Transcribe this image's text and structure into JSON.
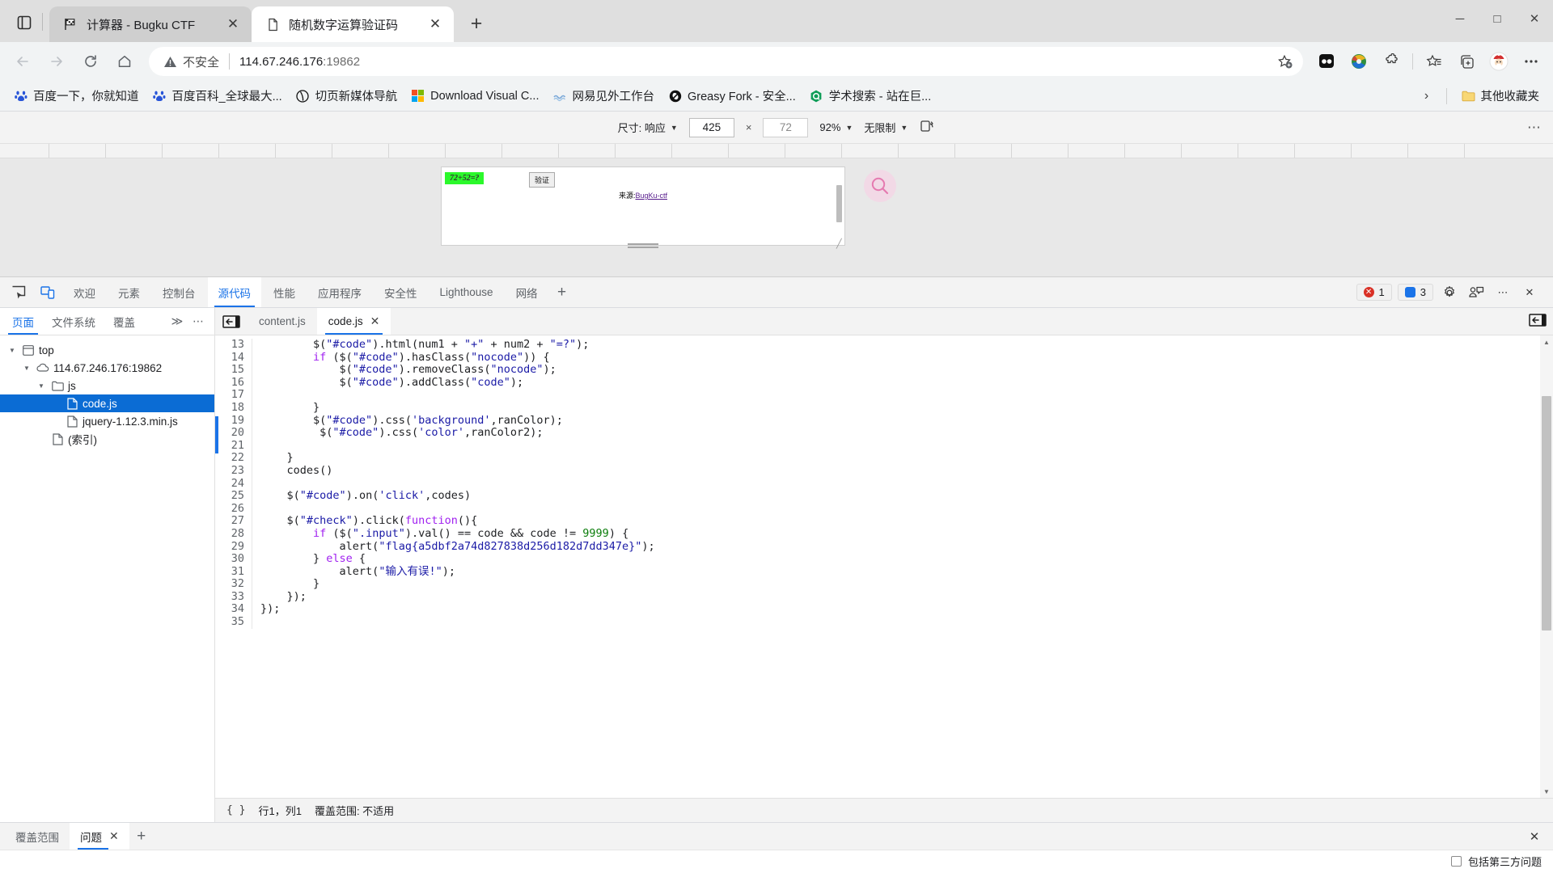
{
  "browser": {
    "tabs": [
      {
        "title": "计算器 - Bugku CTF",
        "favicon": "flag-icon",
        "active": false
      },
      {
        "title": "随机数字运算验证码",
        "favicon": "document-icon",
        "active": true
      }
    ],
    "new_tab_label": "+",
    "window_controls": {
      "minimize": "─",
      "maximize": "□",
      "close": "✕"
    },
    "nav": {
      "back": "←",
      "forward": "→",
      "reload": "↻",
      "home": "⌂"
    },
    "omnibox": {
      "security_label": "不安全",
      "url_host": "114.67.246.176",
      "url_port": ":19862",
      "url_full": "114.67.246.176:19862"
    },
    "toolbar_icons": [
      "add-favorite-icon",
      "collections-dark-icon",
      "idm-icon",
      "extensions-puzzle-icon",
      "favorites-star-icon",
      "add-tab-group-icon",
      "profile-avatar-icon",
      "settings-more-icon"
    ],
    "bookmarks": [
      {
        "label": "百度一下，你就知道",
        "icon": "baidu-icon"
      },
      {
        "label": "百度百科_全球最大...",
        "icon": "baidu-icon"
      },
      {
        "label": "切页新媒体导航",
        "icon": "circle-slash-icon"
      },
      {
        "label": "Download Visual C...",
        "icon": "microsoft-icon"
      },
      {
        "label": "网易见外工作台",
        "icon": "netease-icon"
      },
      {
        "label": "Greasy Fork - 安全...",
        "icon": "greasyfork-icon"
      },
      {
        "label": "学术搜索 - 站在巨...",
        "icon": "quark-icon"
      }
    ],
    "bookmarks_overflow_chevron": "›",
    "other_bookmarks": {
      "label": "其他收藏夹",
      "icon": "folder-icon"
    }
  },
  "device_toolbar": {
    "size_label": "尺寸: 响应",
    "width_value": "425",
    "height_value": "72",
    "times": "×",
    "zoom_label": "92%",
    "throttle_label": "无限制",
    "rotate_icon": "rotate-device-icon",
    "more_icon": "more-options-icon"
  },
  "page_preview": {
    "captcha_code": "72+52=?",
    "captcha_code_bg": "#2bf82b",
    "verify_button": "验证",
    "source_prefix": "来源:",
    "source_link": "BugKu-ctf",
    "magnifier_icon": "search-icon"
  },
  "devtools": {
    "left_icons": [
      "inspect-element-icon",
      "toggle-device-toolbar-icon"
    ],
    "tabs": [
      {
        "label": "欢迎",
        "active": false
      },
      {
        "label": "元素",
        "active": false
      },
      {
        "label": "控制台",
        "active": false
      },
      {
        "label": "源代码",
        "active": true
      },
      {
        "label": "性能",
        "active": false
      },
      {
        "label": "应用程序",
        "active": false
      },
      {
        "label": "安全性",
        "active": false
      },
      {
        "label": "Lighthouse",
        "active": false
      },
      {
        "label": "网络",
        "active": false
      }
    ],
    "add_tab": "+",
    "error_count": "1",
    "message_count": "3",
    "right_icons": [
      "gear-icon",
      "devices-feedback-icon",
      "more-vertical-icon",
      "close-icon"
    ],
    "navigator": {
      "tabs": [
        {
          "label": "页面",
          "active": true
        },
        {
          "label": "文件系统",
          "active": false
        },
        {
          "label": "覆盖",
          "active": false
        }
      ],
      "overflow": "≫",
      "more": "⋯",
      "tree": [
        {
          "label": "top",
          "depth": 0,
          "icon": "frame-icon",
          "twisty": "▼",
          "selected": false
        },
        {
          "label": "114.67.246.176:19862",
          "depth": 1,
          "icon": "cloud-icon",
          "twisty": "▼",
          "selected": false
        },
        {
          "label": "js",
          "depth": 2,
          "icon": "folder-icon",
          "twisty": "▼",
          "selected": false
        },
        {
          "label": "code.js",
          "depth": 3,
          "icon": "file-icon",
          "twisty": "",
          "selected": true
        },
        {
          "label": "jquery-1.12.3.min.js",
          "depth": 3,
          "icon": "file-icon",
          "twisty": "",
          "selected": false
        },
        {
          "label": "(索引)",
          "depth": 2,
          "icon": "file-icon",
          "twisty": "",
          "selected": false
        }
      ]
    },
    "editor": {
      "back_icon": "navigate-back-icon",
      "tabs": [
        {
          "label": "content.js",
          "active": false,
          "closable": false
        },
        {
          "label": "code.js",
          "active": true,
          "closable": true
        }
      ],
      "close_glyph": "✕",
      "collapse_icon": "collapse-sidebar-icon",
      "first_line": 13,
      "lines": [
        "        $(\"#code\").html(num1 + \"+\" + num2 + \"=?\");",
        "        if ($(\"#code\").hasClass(\"nocode\")) {",
        "            $(\"#code\").removeClass(\"nocode\");",
        "            $(\"#code\").addClass(\"code\");",
        "",
        "        }",
        "        $(\"#code\").css('background',ranColor);",
        "         $(\"#code\").css('color',ranColor2);",
        "",
        "    }",
        "    codes()",
        "",
        "    $(\"#code\").on('click',codes)",
        "",
        "    $(\"#check\").click(function(){",
        "        if ($(\".input\").val() == code && code != 9999) {",
        "            alert(\"flag{a5dbf2a74d827838d256d182d7dd347e}\");",
        "        } else {",
        "            alert(\"输入有误!\");",
        "        }",
        "    });",
        "});",
        ""
      ],
      "flag": "flag{a5dbf2a74d827838d256d182d7dd347e}",
      "status": {
        "format_icon": "{ }",
        "cursor": "行1，列1",
        "coverage": "覆盖范围: 不适用"
      }
    },
    "drawer": {
      "tabs": [
        {
          "label": "覆盖范围",
          "active": false,
          "closable": false
        },
        {
          "label": "问题",
          "active": true,
          "closable": true
        }
      ],
      "close_glyph": "✕",
      "add_tab": "+",
      "close_drawer": "✕",
      "third_party_checkbox": {
        "label": "包括第三方问题",
        "checked": false
      }
    }
  },
  "colors": {
    "accent": "#1a73e8",
    "selection": "#0b6cd4",
    "error": "#d93025",
    "captcha_green": "#2bf82b",
    "link_purple": "#551a8b"
  }
}
